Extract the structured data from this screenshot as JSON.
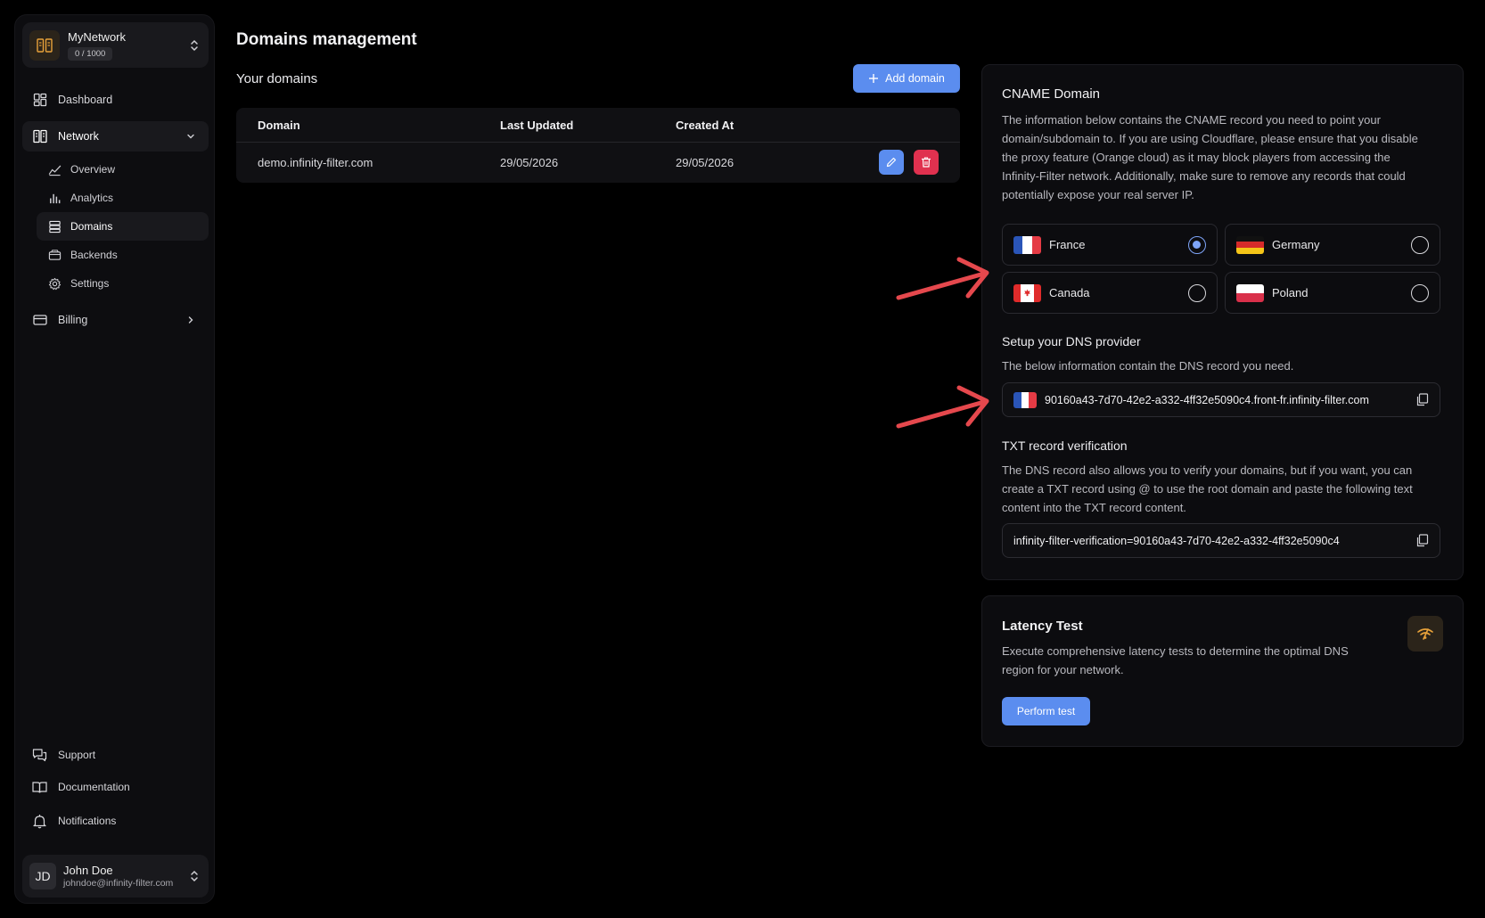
{
  "sidebar": {
    "network": {
      "name": "MyNetwork",
      "quota": "0 / 1000"
    },
    "nav": [
      {
        "label": "Dashboard",
        "icon": "dashboard-icon"
      },
      {
        "label": "Network",
        "icon": "network-icon"
      },
      {
        "label": "Billing",
        "icon": "billing-icon"
      }
    ],
    "network_items": [
      {
        "label": "Overview",
        "icon": "overview-icon"
      },
      {
        "label": "Analytics",
        "icon": "analytics-icon"
      },
      {
        "label": "Domains",
        "icon": "domains-icon",
        "active": true
      },
      {
        "label": "Backends",
        "icon": "backends-icon"
      },
      {
        "label": "Settings",
        "icon": "settings-icon"
      }
    ],
    "footer": [
      {
        "label": "Support",
        "icon": "support-icon"
      },
      {
        "label": "Documentation",
        "icon": "documentation-icon"
      },
      {
        "label": "Notifications",
        "icon": "bell-icon"
      }
    ],
    "user": {
      "initials": "JD",
      "name": "John Doe",
      "email": "johndoe@infinity-filter.com"
    }
  },
  "main": {
    "title": "Domains management",
    "section_title": "Your domains",
    "add_button": "Add domain",
    "table": {
      "headers": [
        "Domain",
        "Last Updated",
        "Created At"
      ],
      "rows": [
        {
          "domain": "demo.infinity-filter.com",
          "updated": "29/05/2026",
          "created": "29/05/2026"
        }
      ]
    }
  },
  "cname": {
    "title": "CNAME Domain",
    "description": "The information below contains the CNAME record you need to point your domain/subdomain to. If you are using Cloudflare, please ensure that you disable the proxy feature (Orange cloud) as it may block players from accessing the Infinity-Filter network. Additionally, make sure to remove any records that could potentially expose your real server IP.",
    "regions": [
      {
        "label": "France",
        "selected": true
      },
      {
        "label": "Germany",
        "selected": false
      },
      {
        "label": "Canada",
        "selected": false
      },
      {
        "label": "Poland",
        "selected": false
      }
    ],
    "dns_title": "Setup your DNS provider",
    "dns_description": "The below information contain the DNS record you need.",
    "dns_value": "90160a43-7d70-42e2-a332-4ff32e5090c4.front-fr.infinity-filter.com",
    "txt_title": "TXT record verification",
    "txt_description": "The DNS record also allows you to verify your domains, but if you want, you can create a TXT record using @ to use the root domain and paste the following text content into the TXT record content.",
    "txt_value": "infinity-filter-verification=90160a43-7d70-42e2-a332-4ff32e5090c4"
  },
  "latency": {
    "title": "Latency Test",
    "description": "Execute comprehensive latency tests to determine the optimal DNS region for your network.",
    "button": "Perform test"
  },
  "colors": {
    "accent": "#5b8def",
    "danger": "#e0314f",
    "annotation_arrow": "#e5484d",
    "brand_icon": "#e8a23a"
  }
}
